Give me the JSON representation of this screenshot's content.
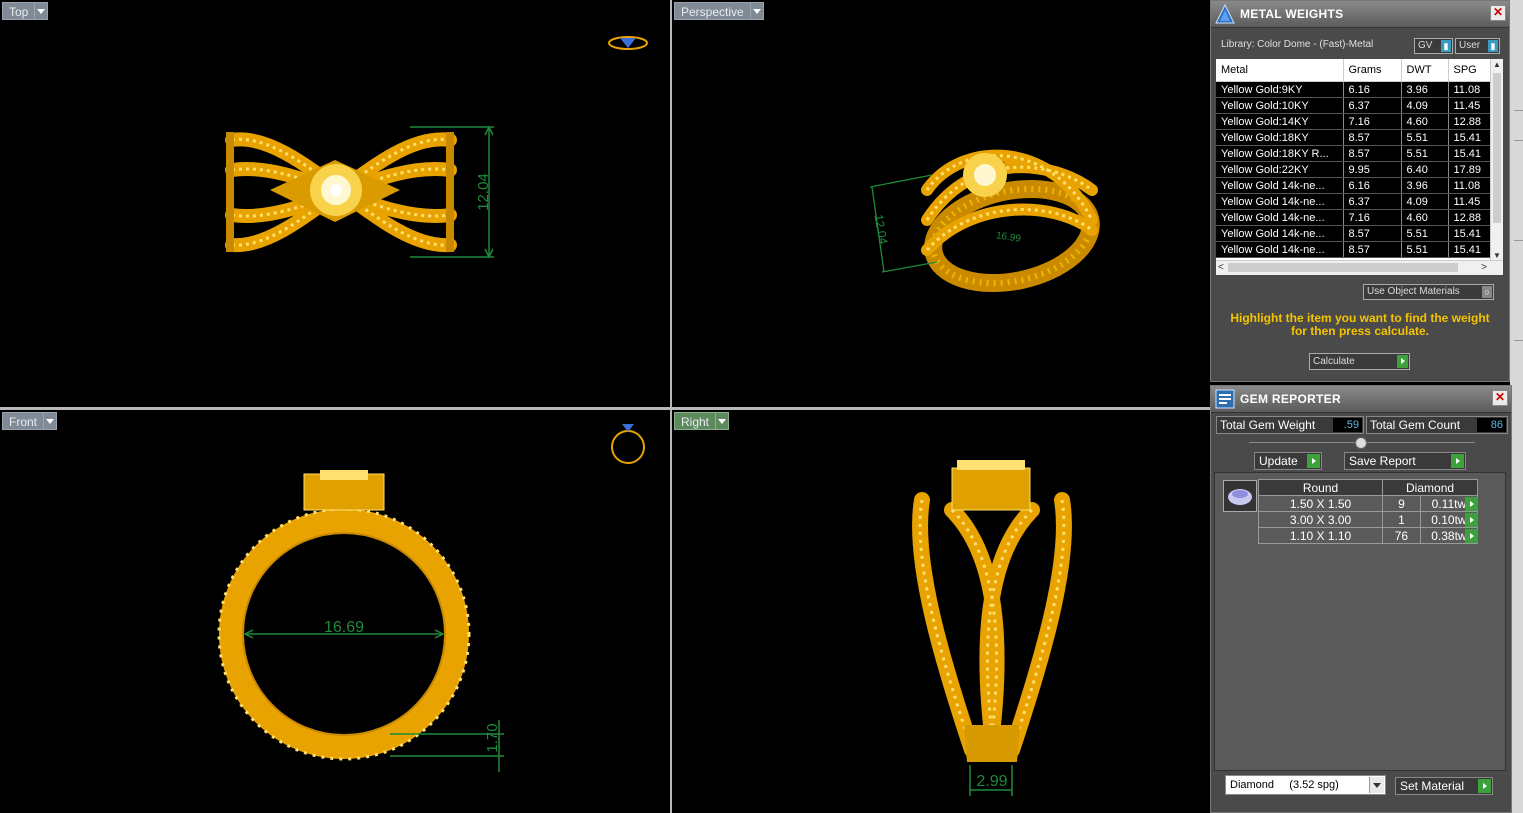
{
  "viewports": {
    "top": {
      "label": "Top",
      "dim_height": "12.04"
    },
    "perspective": {
      "label": "Perspective",
      "dim_height": "12.04",
      "dim_width": "16.99"
    },
    "front": {
      "label": "Front",
      "dim_inner": "16.69",
      "dim_thickness": "1.70"
    },
    "right": {
      "label": "Right",
      "dim_width": "2.99"
    }
  },
  "metal_weights": {
    "title": "METAL WEIGHTS",
    "library": "Library: Color Dome - (Fast)-Metal",
    "gv_label": "GV",
    "user_label": "User",
    "columns": [
      "Metal",
      "Grams",
      "DWT",
      "SPG"
    ],
    "rows": [
      [
        "Yellow Gold:9KY",
        "6.16",
        "3.96",
        "11.08"
      ],
      [
        "Yellow Gold:10KY",
        "6.37",
        "4.09",
        "11.45"
      ],
      [
        "Yellow Gold:14KY",
        "7.16",
        "4.60",
        "12.88"
      ],
      [
        "Yellow Gold:18KY",
        "8.57",
        "5.51",
        "15.41"
      ],
      [
        "Yellow Gold:18KY R...",
        "8.57",
        "5.51",
        "15.41"
      ],
      [
        "Yellow Gold:22KY",
        "9.95",
        "6.40",
        "17.89"
      ],
      [
        "Yellow Gold 14k-ne...",
        "6.16",
        "3.96",
        "11.08"
      ],
      [
        "Yellow Gold 14k-ne...",
        "6.37",
        "4.09",
        "11.45"
      ],
      [
        "Yellow Gold 14k-ne...",
        "7.16",
        "4.60",
        "12.88"
      ],
      [
        "Yellow Gold 14k-ne...",
        "8.57",
        "5.51",
        "15.41"
      ],
      [
        "Yellow Gold 14k-ne...",
        "8.57",
        "5.51",
        "15.41"
      ]
    ],
    "use_object_materials": "Use Object Materials",
    "hint": "Highlight the item you want to find the weight for then press calculate.",
    "calculate": "Calculate"
  },
  "gem_reporter": {
    "title": "GEM REPORTER",
    "total_weight_label": "Total Gem Weight",
    "total_weight_value": ".59",
    "total_count_label": "Total Gem Count",
    "total_count_value": "86",
    "update": "Update",
    "save_report": "Save Report",
    "shape": "Round",
    "material": "Diamond",
    "rows": [
      {
        "size": "1.50 X 1.50",
        "count": "9",
        "tw": "0.11tw"
      },
      {
        "size": "3.00 X 3.00",
        "count": "1",
        "tw": "0.10tw"
      },
      {
        "size": "1.10 X 1.10",
        "count": "76",
        "tw": "0.38tw"
      }
    ],
    "material_select": "Diamond     (3.52 spg)",
    "set_material": "Set Material"
  },
  "colors": {
    "gold": "#f0b400",
    "dim": "#1f8a3a"
  }
}
